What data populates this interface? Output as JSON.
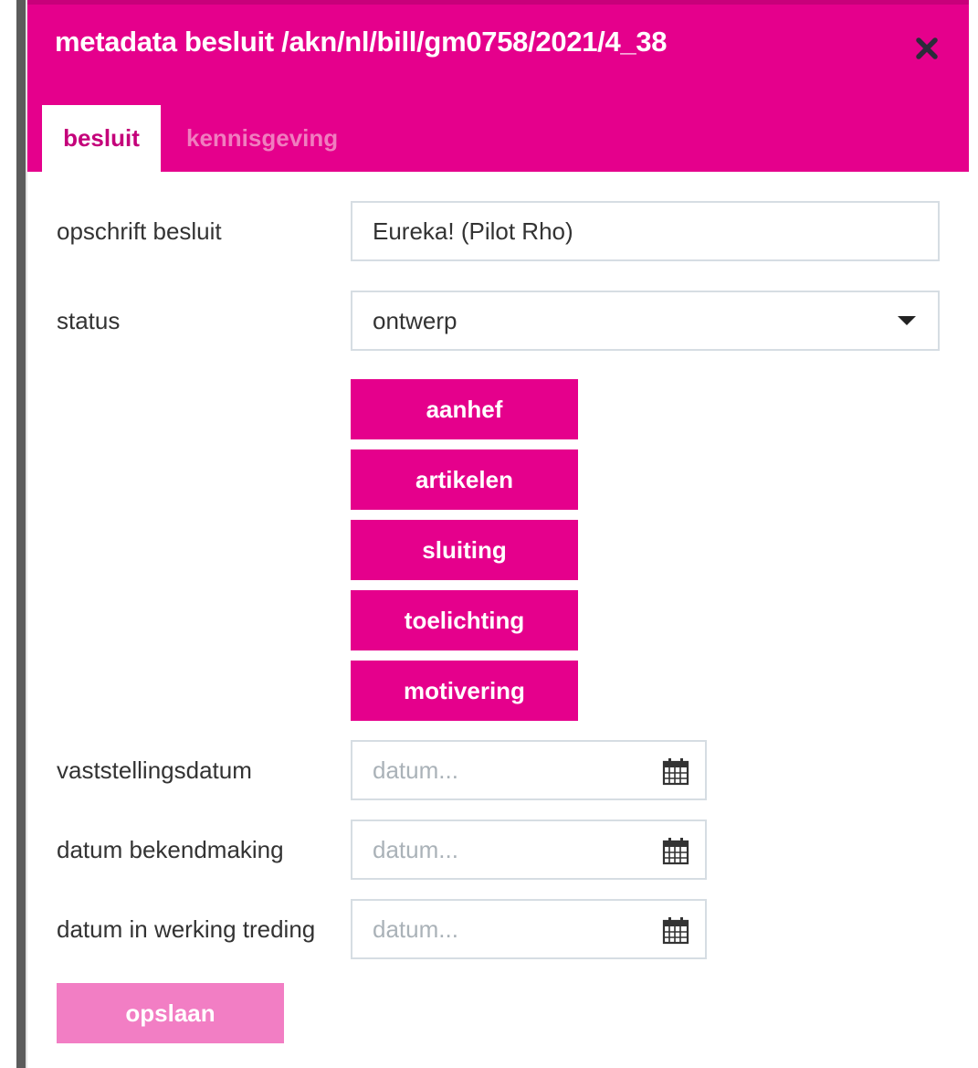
{
  "dialog": {
    "title": "metadata besluit /akn/nl/bill/gm0758/2021/4_38",
    "close_icon": "close-icon",
    "accent_color": "#e5008c"
  },
  "tabs": [
    {
      "label": "besluit",
      "active": true
    },
    {
      "label": "kennisgeving",
      "active": false
    }
  ],
  "form": {
    "opschrift": {
      "label": "opschrift besluit",
      "value": "Eureka! (Pilot Rho)"
    },
    "status": {
      "label": "status",
      "value": "ontwerp",
      "icon": "chevron-down-icon"
    },
    "section_buttons": [
      "aanhef",
      "artikelen",
      "sluiting",
      "toelichting",
      "motivering"
    ],
    "vaststellingsdatum": {
      "label": "vaststellingsdatum",
      "placeholder": "datum..."
    },
    "bekendmaking": {
      "label": "datum bekendmaking",
      "placeholder": "datum..."
    },
    "inwerkingtreding": {
      "label": "datum in werking treding",
      "placeholder": "datum..."
    },
    "calendar_icon": "calendar-icon",
    "save_label": "opslaan"
  }
}
